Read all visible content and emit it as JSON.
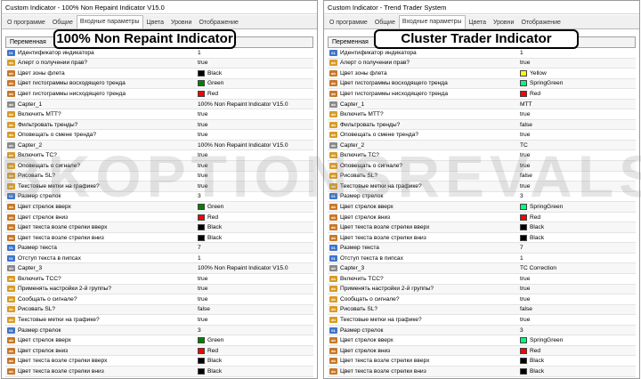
{
  "watermark": "BKOPTIONSREVALS.COM",
  "left": {
    "title": "Custom Indicator - 100% Non Repaint Indicator V15.0",
    "tabs": [
      "О программе",
      "Общие",
      "Входные параметры",
      "Цвета",
      "Уровни",
      "Отображение"
    ],
    "active_tab": 2,
    "overlay": "100% Non Repaint Indicator",
    "header": {
      "name": "Переменная",
      "value": ""
    },
    "rows": [
      {
        "t": "num",
        "name": "Идентификатор индикатора",
        "value": "1",
        "color": ""
      },
      {
        "t": "bool",
        "name": "Алерт о получении прав?",
        "value": "true",
        "color": ""
      },
      {
        "t": "color",
        "name": "Цвет зоны флета",
        "value": "Black",
        "color": "#000000"
      },
      {
        "t": "color",
        "name": "Цвет гистограммы восходящего тренда",
        "value": "Green",
        "color": "#008000"
      },
      {
        "t": "color",
        "name": "Цвет гистограммы нисходящего тренда",
        "value": "Red",
        "color": "#ff0000"
      },
      {
        "t": "str",
        "name": "Capter_1",
        "value": "100% Non Repaint Indicator V15.0",
        "color": ""
      },
      {
        "t": "bool",
        "name": "Включить МТТ?",
        "value": "true",
        "color": ""
      },
      {
        "t": "bool",
        "name": "Фильтровать тренды?",
        "value": "true",
        "color": ""
      },
      {
        "t": "bool",
        "name": "Оповещать о смене тренда?",
        "value": "true",
        "color": ""
      },
      {
        "t": "str",
        "name": "Capter_2",
        "value": "100% Non Repaint Indicator V15.0",
        "color": ""
      },
      {
        "t": "bool",
        "name": "Включить TC?",
        "value": "true",
        "color": ""
      },
      {
        "t": "bool",
        "name": "Оповещать о сигнале?",
        "value": "true",
        "color": ""
      },
      {
        "t": "bool",
        "name": "Рисовать SL?",
        "value": "true",
        "color": ""
      },
      {
        "t": "bool",
        "name": "Текстовые метки на графике?",
        "value": "true",
        "color": ""
      },
      {
        "t": "num",
        "name": "Размер стрелок",
        "value": "3",
        "color": ""
      },
      {
        "t": "color",
        "name": "Цвет стрелок вверх",
        "value": "Green",
        "color": "#008000"
      },
      {
        "t": "color",
        "name": "Цвет стрелок вниз",
        "value": "Red",
        "color": "#ff0000"
      },
      {
        "t": "color",
        "name": "Цвет текста возле стрелки вверх",
        "value": "Black",
        "color": "#000000"
      },
      {
        "t": "color",
        "name": "Цвет текста возле стрелки вниз",
        "value": "Black",
        "color": "#000000"
      },
      {
        "t": "num",
        "name": "Размер текста",
        "value": "7",
        "color": ""
      },
      {
        "t": "num",
        "name": "Отступ текста в пипсах",
        "value": "1",
        "color": ""
      },
      {
        "t": "str",
        "name": "Capter_3",
        "value": "100% Non Repaint Indicator V15.0",
        "color": ""
      },
      {
        "t": "bool",
        "name": "Включить TCC?",
        "value": "true",
        "color": ""
      },
      {
        "t": "bool",
        "name": "Применять настройки 2-й группы?",
        "value": "true",
        "color": ""
      },
      {
        "t": "bool",
        "name": "Сообщать о сигнале?",
        "value": "true",
        "color": ""
      },
      {
        "t": "bool",
        "name": "Рисовать SL?",
        "value": "false",
        "color": ""
      },
      {
        "t": "bool",
        "name": "Текстовые метки на графике?",
        "value": "true",
        "color": ""
      },
      {
        "t": "num",
        "name": "Размер стрелок",
        "value": "3",
        "color": ""
      },
      {
        "t": "color",
        "name": "Цвет стрелок вверх",
        "value": "Green",
        "color": "#008000"
      },
      {
        "t": "color",
        "name": "Цвет стрелок вниз",
        "value": "Red",
        "color": "#ff0000"
      },
      {
        "t": "color",
        "name": "Цвет текста возле стрелки вверх",
        "value": "Black",
        "color": "#000000"
      },
      {
        "t": "color",
        "name": "Цвет текста возле стрелки вниз",
        "value": "Black",
        "color": "#000000"
      }
    ]
  },
  "right": {
    "title": "Custom Indicator - Trend Trader System",
    "tabs": [
      "О программе",
      "Общие",
      "Входные параметры",
      "Цвета",
      "Уровни",
      "Отображение"
    ],
    "active_tab": 2,
    "overlay": "Cluster Trader Indicator",
    "header": {
      "name": "Переменная",
      "value": ""
    },
    "rows": [
      {
        "t": "num",
        "name": "Идентификатор индикатора",
        "value": "1",
        "color": ""
      },
      {
        "t": "bool",
        "name": "Алерт о получении прав?",
        "value": "true",
        "color": ""
      },
      {
        "t": "color",
        "name": "Цвет зоны флета",
        "value": "Yellow",
        "color": "#ffff00"
      },
      {
        "t": "color",
        "name": "Цвет гистограммы восходящего тренда",
        "value": "SpringGreen",
        "color": "#00ff7f"
      },
      {
        "t": "color",
        "name": "Цвет гистограммы нисходящего тренда",
        "value": "Red",
        "color": "#ff0000"
      },
      {
        "t": "str",
        "name": "Capter_1",
        "value": "MTT",
        "color": ""
      },
      {
        "t": "bool",
        "name": "Включить МТТ?",
        "value": "true",
        "color": ""
      },
      {
        "t": "bool",
        "name": "Фильтровать тренды?",
        "value": "false",
        "color": ""
      },
      {
        "t": "bool",
        "name": "Оповещать о смене тренда?",
        "value": "true",
        "color": ""
      },
      {
        "t": "str",
        "name": "Capter_2",
        "value": "TC",
        "color": ""
      },
      {
        "t": "bool",
        "name": "Включить TC?",
        "value": "true",
        "color": ""
      },
      {
        "t": "bool",
        "name": "Оповещать о сигнале?",
        "value": "true",
        "color": ""
      },
      {
        "t": "bool",
        "name": "Рисовать SL?",
        "value": "false",
        "color": ""
      },
      {
        "t": "bool",
        "name": "Текстовые метки на графике?",
        "value": "true",
        "color": ""
      },
      {
        "t": "num",
        "name": "Размер стрелок",
        "value": "3",
        "color": ""
      },
      {
        "t": "color",
        "name": "Цвет стрелок вверх",
        "value": "SpringGreen",
        "color": "#00ff7f"
      },
      {
        "t": "color",
        "name": "Цвет стрелок вниз",
        "value": "Red",
        "color": "#ff0000"
      },
      {
        "t": "color",
        "name": "Цвет текста возле стрелки вверх",
        "value": "Black",
        "color": "#000000"
      },
      {
        "t": "color",
        "name": "Цвет текста возле стрелки вниз",
        "value": "Black",
        "color": "#000000"
      },
      {
        "t": "num",
        "name": "Размер текста",
        "value": "7",
        "color": ""
      },
      {
        "t": "num",
        "name": "Отступ текста в пипсах",
        "value": "1",
        "color": ""
      },
      {
        "t": "str",
        "name": "Capter_3",
        "value": "TC Correction",
        "color": ""
      },
      {
        "t": "bool",
        "name": "Включить TCC?",
        "value": "true",
        "color": ""
      },
      {
        "t": "bool",
        "name": "Применять настройки 2-й группы?",
        "value": "true",
        "color": ""
      },
      {
        "t": "bool",
        "name": "Сообщать о сигнале?",
        "value": "true",
        "color": ""
      },
      {
        "t": "bool",
        "name": "Рисовать SL?",
        "value": "false",
        "color": ""
      },
      {
        "t": "bool",
        "name": "Текстовые метки на графике?",
        "value": "true",
        "color": ""
      },
      {
        "t": "num",
        "name": "Размер стрелок",
        "value": "3",
        "color": ""
      },
      {
        "t": "color",
        "name": "Цвет стрелок вверх",
        "value": "SpringGreen",
        "color": "#00ff7f"
      },
      {
        "t": "color",
        "name": "Цвет стрелок вниз",
        "value": "Red",
        "color": "#ff0000"
      },
      {
        "t": "color",
        "name": "Цвет текста возле стрелки вверх",
        "value": "Black",
        "color": "#000000"
      },
      {
        "t": "color",
        "name": "Цвет текста возле стрелки вниз",
        "value": "Black",
        "color": "#000000"
      }
    ]
  }
}
